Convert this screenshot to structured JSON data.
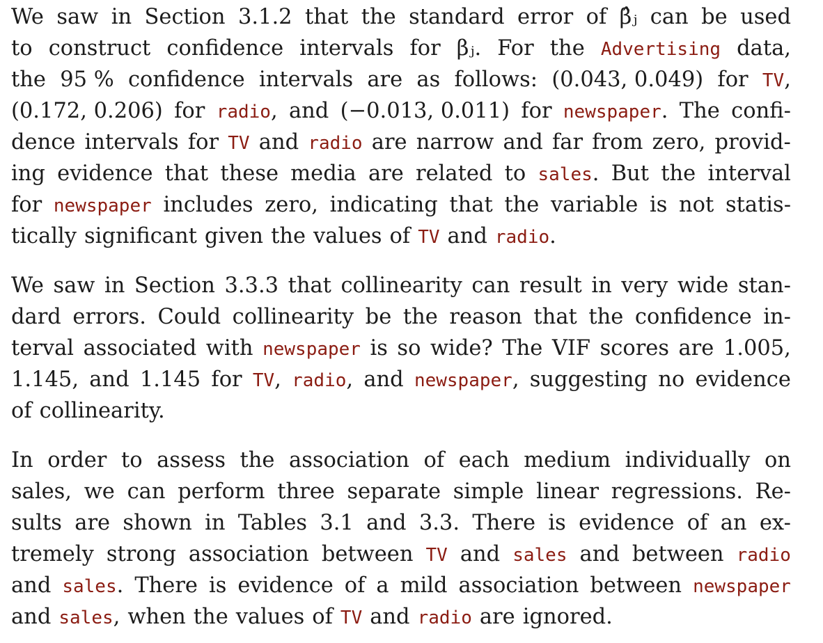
{
  "paragraphs": [
    {
      "lines": [
        [
          [
            "t",
            "We"
          ],
          [
            "t",
            "saw"
          ],
          [
            "t",
            "in"
          ],
          [
            "t",
            "Section"
          ],
          [
            "t",
            "3.1.2"
          ],
          [
            "t",
            "that"
          ],
          [
            "t",
            "the"
          ],
          [
            "t",
            "standard"
          ],
          [
            "t",
            "error"
          ],
          [
            "t",
            "of"
          ],
          [
            "t",
            "β̂ⱼ"
          ],
          [
            "t",
            "can"
          ],
          [
            "t",
            "be"
          ],
          [
            "t",
            "used"
          ]
        ],
        [
          [
            "t",
            "to"
          ],
          [
            "t",
            "construct"
          ],
          [
            "t",
            "confidence"
          ],
          [
            "t",
            "intervals"
          ],
          [
            "t",
            "for"
          ],
          [
            "t",
            "βⱼ."
          ],
          [
            "t",
            "For"
          ],
          [
            "t",
            "the"
          ],
          [
            "c",
            "Advertising"
          ],
          [
            "t",
            "data,"
          ]
        ],
        [
          [
            "t",
            "the"
          ],
          [
            "t",
            "95 %"
          ],
          [
            "t",
            "confidence"
          ],
          [
            "t",
            "intervals"
          ],
          [
            "t",
            "are"
          ],
          [
            "t",
            "as"
          ],
          [
            "t",
            "follows:"
          ],
          [
            "t",
            "(0.043, 0.049)"
          ],
          [
            "t",
            "for"
          ],
          [
            "c",
            "TV",
            ","
          ]
        ],
        [
          [
            "t",
            "(0.172, 0.206)"
          ],
          [
            "t",
            "for"
          ],
          [
            "c",
            "radio",
            ","
          ],
          [
            "t",
            "and"
          ],
          [
            "t",
            "(−0.013, 0.011)"
          ],
          [
            "t",
            "for"
          ],
          [
            "c",
            "newspaper",
            "."
          ],
          [
            "t",
            "The"
          ],
          [
            "t",
            "confi-"
          ]
        ],
        [
          [
            "t",
            "dence"
          ],
          [
            "t",
            "intervals"
          ],
          [
            "t",
            "for"
          ],
          [
            "c",
            "TV"
          ],
          [
            "t",
            "and"
          ],
          [
            "c",
            "radio"
          ],
          [
            "t",
            "are"
          ],
          [
            "t",
            "narrow"
          ],
          [
            "t",
            "and"
          ],
          [
            "t",
            "far"
          ],
          [
            "t",
            "from"
          ],
          [
            "t",
            "zero,"
          ],
          [
            "t",
            "provid-"
          ]
        ],
        [
          [
            "t",
            "ing"
          ],
          [
            "t",
            "evidence"
          ],
          [
            "t",
            "that"
          ],
          [
            "t",
            "these"
          ],
          [
            "t",
            "media"
          ],
          [
            "t",
            "are"
          ],
          [
            "t",
            "related"
          ],
          [
            "t",
            "to"
          ],
          [
            "c",
            "sales",
            "."
          ],
          [
            "t",
            "But"
          ],
          [
            "t",
            "the"
          ],
          [
            "t",
            "interval"
          ]
        ],
        [
          [
            "t",
            "for"
          ],
          [
            "c",
            "newspaper"
          ],
          [
            "t",
            "includes"
          ],
          [
            "t",
            "zero,"
          ],
          [
            "t",
            "indicating"
          ],
          [
            "t",
            "that"
          ],
          [
            "t",
            "the"
          ],
          [
            "t",
            "variable"
          ],
          [
            "t",
            "is"
          ],
          [
            "t",
            "not"
          ],
          [
            "t",
            "statis-"
          ]
        ],
        [
          [
            "t",
            "tically"
          ],
          [
            "t",
            "significant"
          ],
          [
            "t",
            "given"
          ],
          [
            "t",
            "the"
          ],
          [
            "t",
            "values"
          ],
          [
            "t",
            "of"
          ],
          [
            "c",
            "TV"
          ],
          [
            "t",
            "and"
          ],
          [
            "c",
            "radio",
            "."
          ]
        ]
      ]
    },
    {
      "lines": [
        [
          [
            "t",
            "We"
          ],
          [
            "t",
            "saw"
          ],
          [
            "t",
            "in"
          ],
          [
            "t",
            "Section"
          ],
          [
            "t",
            "3.3.3"
          ],
          [
            "t",
            "that"
          ],
          [
            "t",
            "collinearity"
          ],
          [
            "t",
            "can"
          ],
          [
            "t",
            "result"
          ],
          [
            "t",
            "in"
          ],
          [
            "t",
            "very"
          ],
          [
            "t",
            "wide"
          ],
          [
            "t",
            "stan-"
          ]
        ],
        [
          [
            "t",
            "dard"
          ],
          [
            "t",
            "errors."
          ],
          [
            "t",
            "Could"
          ],
          [
            "t",
            "collinearity"
          ],
          [
            "t",
            "be"
          ],
          [
            "t",
            "the"
          ],
          [
            "t",
            "reason"
          ],
          [
            "t",
            "that"
          ],
          [
            "t",
            "the"
          ],
          [
            "t",
            "confidence"
          ],
          [
            "t",
            "in-"
          ]
        ],
        [
          [
            "t",
            "terval"
          ],
          [
            "t",
            "associated"
          ],
          [
            "t",
            "with"
          ],
          [
            "c",
            "newspaper"
          ],
          [
            "t",
            "is"
          ],
          [
            "t",
            "so"
          ],
          [
            "t",
            "wide?"
          ],
          [
            "t",
            "The"
          ],
          [
            "t",
            "VIF"
          ],
          [
            "t",
            "scores"
          ],
          [
            "t",
            "are"
          ],
          [
            "t",
            "1.005,"
          ]
        ],
        [
          [
            "t",
            "1.145,"
          ],
          [
            "t",
            "and"
          ],
          [
            "t",
            "1.145"
          ],
          [
            "t",
            "for"
          ],
          [
            "c",
            "TV",
            ","
          ],
          [
            "c",
            "radio",
            ","
          ],
          [
            "t",
            "and"
          ],
          [
            "c",
            "newspaper",
            ","
          ],
          [
            "t",
            "suggesting"
          ],
          [
            "t",
            "no"
          ],
          [
            "t",
            "evidence"
          ]
        ],
        [
          [
            "t",
            "of"
          ],
          [
            "t",
            "collinearity."
          ]
        ]
      ]
    },
    {
      "lines": [
        [
          [
            "t",
            "In"
          ],
          [
            "t",
            "order"
          ],
          [
            "t",
            "to"
          ],
          [
            "t",
            "assess"
          ],
          [
            "t",
            "the"
          ],
          [
            "t",
            "association"
          ],
          [
            "t",
            "of"
          ],
          [
            "t",
            "each"
          ],
          [
            "t",
            "medium"
          ],
          [
            "t",
            "individually"
          ],
          [
            "t",
            "on"
          ]
        ],
        [
          [
            "t",
            "sales,"
          ],
          [
            "t",
            "we"
          ],
          [
            "t",
            "can"
          ],
          [
            "t",
            "perform"
          ],
          [
            "t",
            "three"
          ],
          [
            "t",
            "separate"
          ],
          [
            "t",
            "simple"
          ],
          [
            "t",
            "linear"
          ],
          [
            "t",
            "regressions."
          ],
          [
            "t",
            "Re-"
          ]
        ],
        [
          [
            "t",
            "sults"
          ],
          [
            "t",
            "are"
          ],
          [
            "t",
            "shown"
          ],
          [
            "t",
            "in"
          ],
          [
            "t",
            "Tables"
          ],
          [
            "t",
            "3.1"
          ],
          [
            "t",
            "and"
          ],
          [
            "t",
            "3.3."
          ],
          [
            "t",
            "There"
          ],
          [
            "t",
            "is"
          ],
          [
            "t",
            "evidence"
          ],
          [
            "t",
            "of"
          ],
          [
            "t",
            "an"
          ],
          [
            "t",
            "ex-"
          ]
        ],
        [
          [
            "t",
            "tremely"
          ],
          [
            "t",
            "strong"
          ],
          [
            "t",
            "association"
          ],
          [
            "t",
            "between"
          ],
          [
            "c",
            "TV"
          ],
          [
            "t",
            "and"
          ],
          [
            "c",
            "sales"
          ],
          [
            "t",
            "and"
          ],
          [
            "t",
            "between"
          ],
          [
            "c",
            "radio"
          ]
        ],
        [
          [
            "t",
            "and"
          ],
          [
            "c",
            "sales",
            "."
          ],
          [
            "t",
            "There"
          ],
          [
            "t",
            "is"
          ],
          [
            "t",
            "evidence"
          ],
          [
            "t",
            "of"
          ],
          [
            "t",
            "a"
          ],
          [
            "t",
            "mild"
          ],
          [
            "t",
            "association"
          ],
          [
            "t",
            "between"
          ],
          [
            "c",
            "newspaper"
          ]
        ],
        [
          [
            "t",
            "and"
          ],
          [
            "c",
            "sales",
            ","
          ],
          [
            "t",
            "when"
          ],
          [
            "t",
            "the"
          ],
          [
            "t",
            "values"
          ],
          [
            "t",
            "of"
          ],
          [
            "c",
            "TV"
          ],
          [
            "t",
            "and"
          ],
          [
            "c",
            "radio"
          ],
          [
            "t",
            "are"
          ],
          [
            "t",
            "ignored."
          ]
        ]
      ]
    }
  ]
}
